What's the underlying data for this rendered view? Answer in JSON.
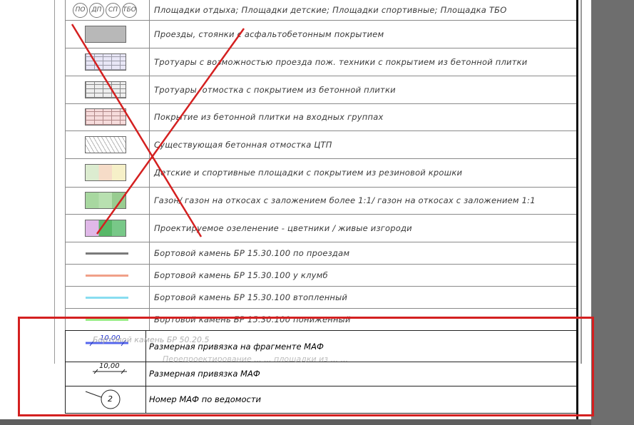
{
  "legend_rows": [
    {
      "symbol": "circles",
      "badges": [
        "ПО",
        "ДП",
        "СП",
        "ТБО"
      ],
      "text": "Площадки отдыха; Площадки детские; Площадки спортивные; Площадка ТБО"
    },
    {
      "symbol": "asphalt",
      "text": "Проезды, стоянки с асфальтобетонным покрытием"
    },
    {
      "symbol": "tile-fire",
      "text": "Тротуары с возможностью проезда пож. техники с покрытием из бетонной плитки"
    },
    {
      "symbol": "tile-gray",
      "text": "Тротуары, отмостка с покрытием из бетонной плитки"
    },
    {
      "symbol": "tile-pink",
      "text": "Покрытие из бетонной плитки на входных группах"
    },
    {
      "symbol": "hatch",
      "text": "Существующая бетонная отмостка ЦТП"
    },
    {
      "symbol": "rubber",
      "text": "Детские и спортивные площадки с покрытием из резиновой крошки"
    },
    {
      "symbol": "lawn",
      "text": "Газон/ газон на откосах с заложением более 1:1/ газон на откосах с заложением 1:1"
    },
    {
      "symbol": "planting",
      "text": "Проектируемое озеленение - цветники / живые изгороди"
    },
    {
      "symbol": "line",
      "color": "#7a7a7a",
      "text": "Бортовой камень БР 15.30.100 по проездам"
    },
    {
      "symbol": "line",
      "color": "#f0a088",
      "text": "Бортовой камень БР 15.30.100 у клумб"
    },
    {
      "symbol": "line",
      "color": "#88ddf0",
      "text": "Бортовой камень БР 15.30.100 втопленный"
    },
    {
      "symbol": "line",
      "color": "#99ee88",
      "text": "Бортовой камень БР 15.30.100 пониженный"
    }
  ],
  "ghost_texts": [
    "Бортовой камень БР 50.20.5",
    "Перепроектирование ... ... площадки из ... ..."
  ],
  "front_rows": [
    {
      "symbol": "dim-blue",
      "value": "10,00",
      "text": "Размерная привязка на фрагменте МАФ"
    },
    {
      "symbol": "dim-black",
      "value": "10,00",
      "text": "Размерная привязка МАФ"
    },
    {
      "symbol": "callout",
      "value": "2",
      "text": "Номер МАФ по ведомости"
    }
  ],
  "colors": {
    "highlight_box": "#d42020",
    "cross_out": "#d42020"
  }
}
